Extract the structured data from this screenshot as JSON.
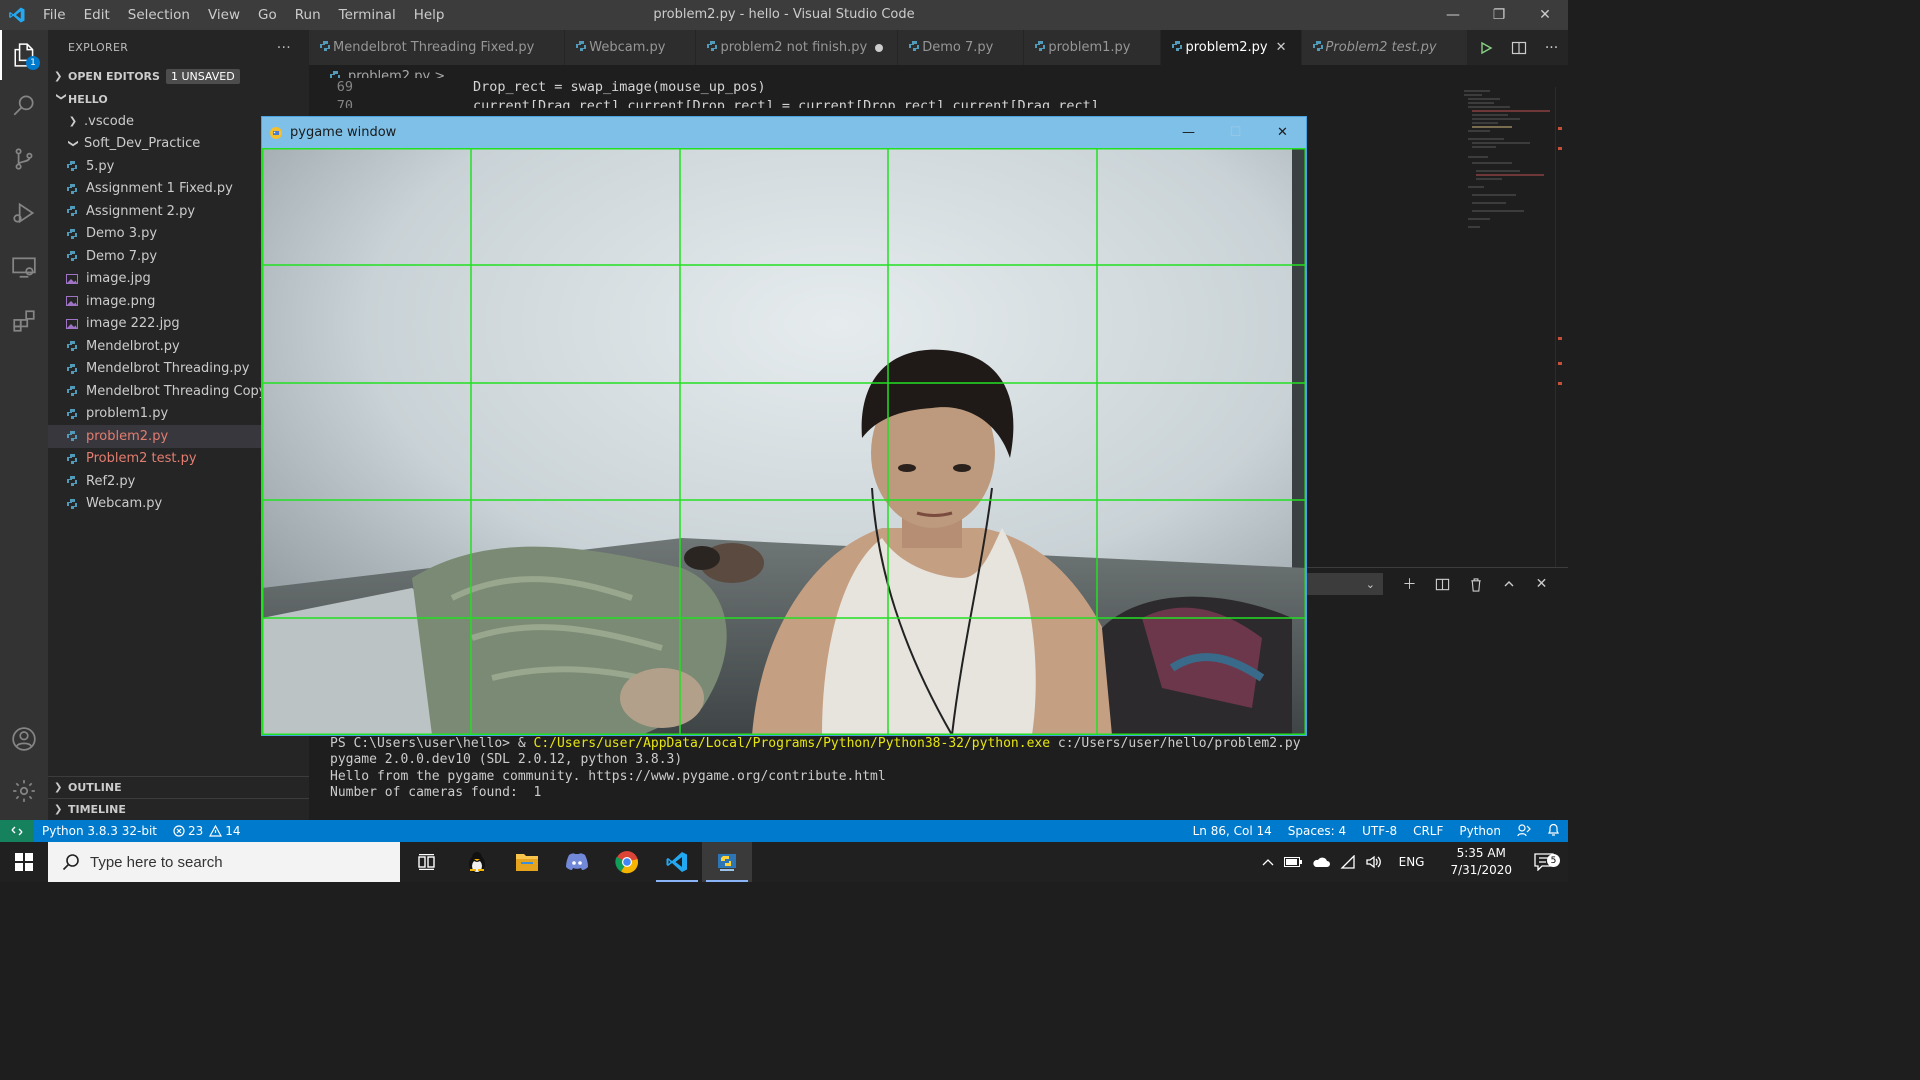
{
  "window": {
    "title": "problem2.py - hello - Visual Studio Code",
    "menu": [
      "File",
      "Edit",
      "Selection",
      "View",
      "Go",
      "Run",
      "Terminal",
      "Help"
    ]
  },
  "activity": {
    "explorer_badge": "1"
  },
  "explorer": {
    "header": "EXPLORER",
    "more": "···",
    "open_editors": "OPEN EDITORS",
    "unsaved_badge": "1 UNSAVED",
    "folder": "HELLO",
    "items": [
      {
        "label": ".vscode",
        "kind": "folder-collapsed",
        "depth": 1
      },
      {
        "label": "Soft_Dev_Practice",
        "kind": "folder-expanded",
        "depth": 1
      },
      {
        "label": "5.py",
        "kind": "py",
        "depth": 1
      },
      {
        "label": "Assignment 1 Fixed.py",
        "kind": "py",
        "depth": 1
      },
      {
        "label": "Assignment 2.py",
        "kind": "py",
        "depth": 1
      },
      {
        "label": "Demo 3.py",
        "kind": "py",
        "depth": 1
      },
      {
        "label": "Demo 7.py",
        "kind": "py",
        "depth": 1
      },
      {
        "label": "image.jpg",
        "kind": "img",
        "depth": 1
      },
      {
        "label": "image.png",
        "kind": "img",
        "depth": 1
      },
      {
        "label": "image 222.jpg",
        "kind": "img",
        "depth": 1
      },
      {
        "label": "Mendelbrot.py",
        "kind": "py",
        "depth": 1
      },
      {
        "label": "Mendelbrot Threading.py",
        "kind": "py",
        "depth": 1
      },
      {
        "label": "Mendelbrot Threading Copy.py",
        "kind": "py",
        "depth": 1
      },
      {
        "label": "problem1.py",
        "kind": "py",
        "depth": 1
      },
      {
        "label": "problem2.py",
        "kind": "py",
        "depth": 1,
        "selected": true,
        "modified": true
      },
      {
        "label": "Problem2 test.py",
        "kind": "py",
        "depth": 1,
        "modified": true
      },
      {
        "label": "Ref2.py",
        "kind": "py",
        "depth": 1
      },
      {
        "label": "Webcam.py",
        "kind": "py",
        "depth": 1
      }
    ],
    "outline": "OUTLINE",
    "timeline": "TIMELINE"
  },
  "tabs": [
    {
      "label": "Mendelbrot Threading Fixed.py"
    },
    {
      "label": "Webcam.py"
    },
    {
      "label": "problem2 not finish.py",
      "dirty": true
    },
    {
      "label": "Demo 7.py"
    },
    {
      "label": "problem1.py"
    },
    {
      "label": "problem2.py",
      "active": true
    },
    {
      "label": "Problem2 test.py",
      "italic": true
    }
  ],
  "breadcrumb": "problem2.py > ...",
  "code": [
    {
      "ln": "69",
      "text": "Drop_rect = swap_image(mouse_up_pos)"
    },
    {
      "ln": "70",
      "text": "current[Drag_rect],current[Drop_rect] = current[Drop_rect],current[Drag_rect]"
    }
  ],
  "terminal": {
    "prompt_prefix": "PS C:\\Users\\user\\hello> & ",
    "exe_path": "C:/Users/user/AppData/Local/Programs/Python/Python38-32/python.exe",
    "script_arg": " c:/Users/user/hello/problem2.py",
    "lines": [
      "pygame 2.0.0.dev10 (SDL 2.0.12, python 3.8.3)",
      "Hello from the pygame community. https://www.pygame.org/contribute.html",
      "Number of cameras found:  1"
    ]
  },
  "pygame": {
    "title": "pygame window",
    "grid_color": "#22e022"
  },
  "status": {
    "interpreter": "Python 3.8.3 32-bit",
    "errors": "23",
    "warnings": "14",
    "position": "Ln 86, Col 14",
    "spaces": "Spaces: 4",
    "encoding": "UTF-8",
    "eol": "CRLF",
    "language": "Python"
  },
  "taskbar": {
    "search_placeholder": "Type here to search",
    "lang": "ENG",
    "time": "5:35 AM",
    "date": "7/31/2020",
    "notif_count": "5"
  },
  "colors": {
    "accent": "#007acc",
    "modified": "#e37d6f",
    "python_icon": "#519aba",
    "image_icon": "#a074c4"
  }
}
